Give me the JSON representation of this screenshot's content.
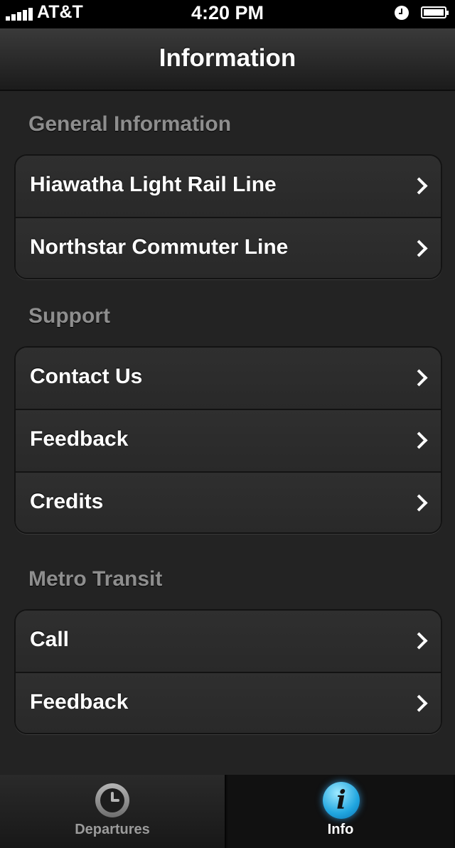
{
  "status_bar": {
    "carrier": "AT&T",
    "time": "4:20 PM"
  },
  "navbar": {
    "title": "Information"
  },
  "sections": [
    {
      "title": "General Information",
      "items": [
        "Hiawatha Light Rail Line",
        "Northstar Commuter Line"
      ]
    },
    {
      "title": "Support",
      "items": [
        "Contact Us",
        "Feedback",
        "Credits"
      ]
    },
    {
      "title": "Metro Transit",
      "items": [
        "Call",
        "Feedback"
      ]
    }
  ],
  "tabbar": {
    "tabs": [
      {
        "label": "Departures",
        "icon": "clock-icon",
        "selected": false
      },
      {
        "label": "Info",
        "icon": "info-icon",
        "selected": true
      }
    ]
  },
  "icons": {
    "info_glyph": "i"
  },
  "colors": {
    "background": "#232323",
    "section_title": "#8e8e8e",
    "info_accent": "#21a6e0"
  }
}
